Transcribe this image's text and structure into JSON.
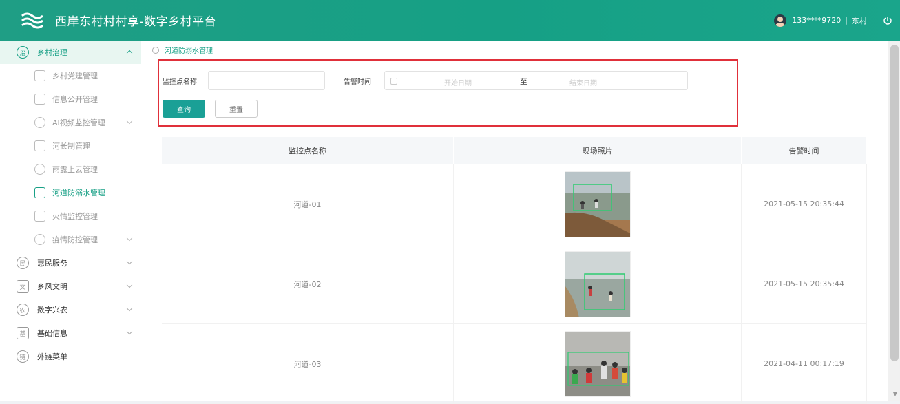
{
  "header": {
    "title": "西岸东村村村享-数字乡村平台",
    "user": "133****9720",
    "separator": "|",
    "village": "东村",
    "logo_icon": "waves-logo-icon",
    "power_icon": "power-icon"
  },
  "sidebar": {
    "group": "乡村治理",
    "sub_items": [
      {
        "label": "乡村党建管理",
        "active": false
      },
      {
        "label": "信息公开管理",
        "active": false
      },
      {
        "label": "AI视频监控管理",
        "active": false,
        "expand": true
      },
      {
        "label": "河长制管理",
        "active": false
      },
      {
        "label": "雨露上云管理",
        "active": false
      },
      {
        "label": "河道防溺水管理",
        "active": true
      },
      {
        "label": "火情监控管理",
        "active": false
      },
      {
        "label": "疫情防控管理",
        "active": false,
        "expand": true
      }
    ],
    "groups": [
      {
        "label": "惠民服务"
      },
      {
        "label": "乡风文明"
      },
      {
        "label": "数字兴农"
      },
      {
        "label": "基础信息"
      },
      {
        "label": "外链菜单"
      }
    ]
  },
  "breadcrumb": "河道防溺水管理",
  "search": {
    "name_label": "监控点名称",
    "name_value": "",
    "time_label": "告警时间",
    "start_placeholder": "开始日期",
    "to_label": "至",
    "end_placeholder": "结束日期",
    "query_button": "查询",
    "reset_button": "重置"
  },
  "table": {
    "headers": [
      "监控点名称",
      "现场照片",
      "告警时间"
    ],
    "rows": [
      {
        "name": "河道-01",
        "time": "2021-05-15 20:35:44"
      },
      {
        "name": "河道-02",
        "time": "2021-05-15 20:35:44"
      },
      {
        "name": "河道-03",
        "time": "2021-04-11 00:17:19"
      }
    ]
  },
  "colors": {
    "header": "#16a085",
    "accent": "#1aa096",
    "highlight_border": "#e0303a",
    "detect_box": "#2ecc71"
  }
}
